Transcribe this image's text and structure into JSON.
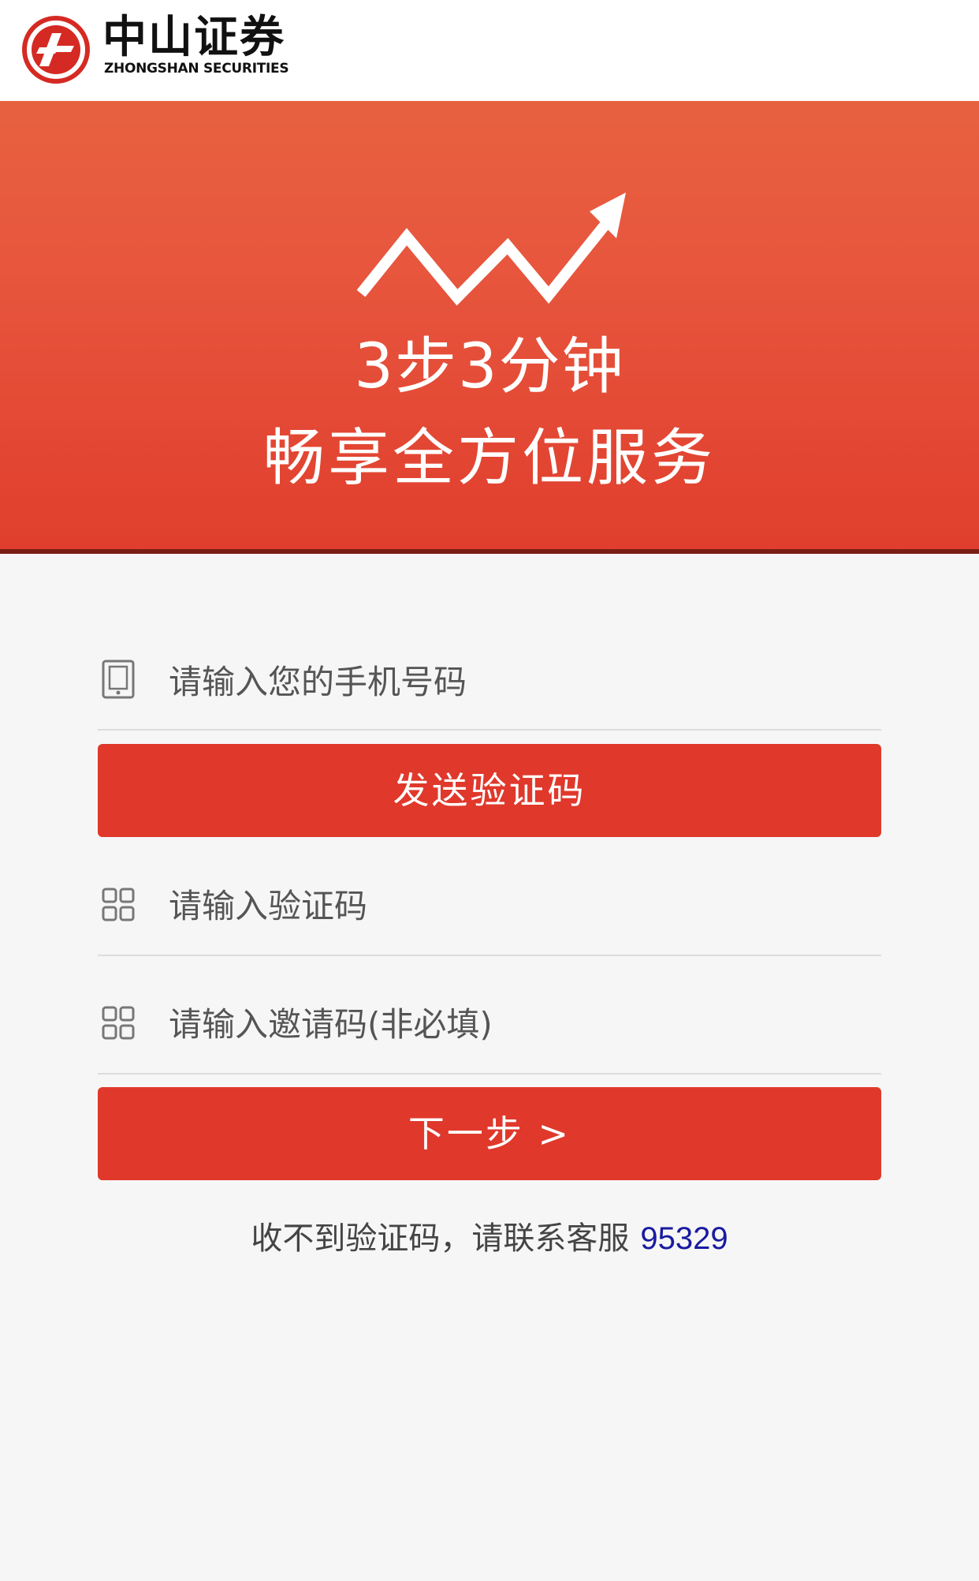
{
  "header": {
    "logo_cn": "中山证券",
    "logo_en": "ZHONGSHAN SECURITIES"
  },
  "banner": {
    "line1": "3步3分钟",
    "line2": "畅享全方位服务"
  },
  "form": {
    "phone_placeholder": "请输入您的手机号码",
    "send_code_label": "发送验证码",
    "code_placeholder": "请输入验证码",
    "invite_placeholder": "请输入邀请码(非必填)",
    "next_label": "下一步 >"
  },
  "footer": {
    "note": "收不到验证码，请联系客服",
    "phone": "95329"
  },
  "colors": {
    "brand_red": "#e0382b",
    "phone_link": "#1a1aa0"
  },
  "icons": {
    "phone_field": "mobile-phone-icon",
    "code_field": "grid-icon",
    "invite_field": "grid-icon"
  }
}
